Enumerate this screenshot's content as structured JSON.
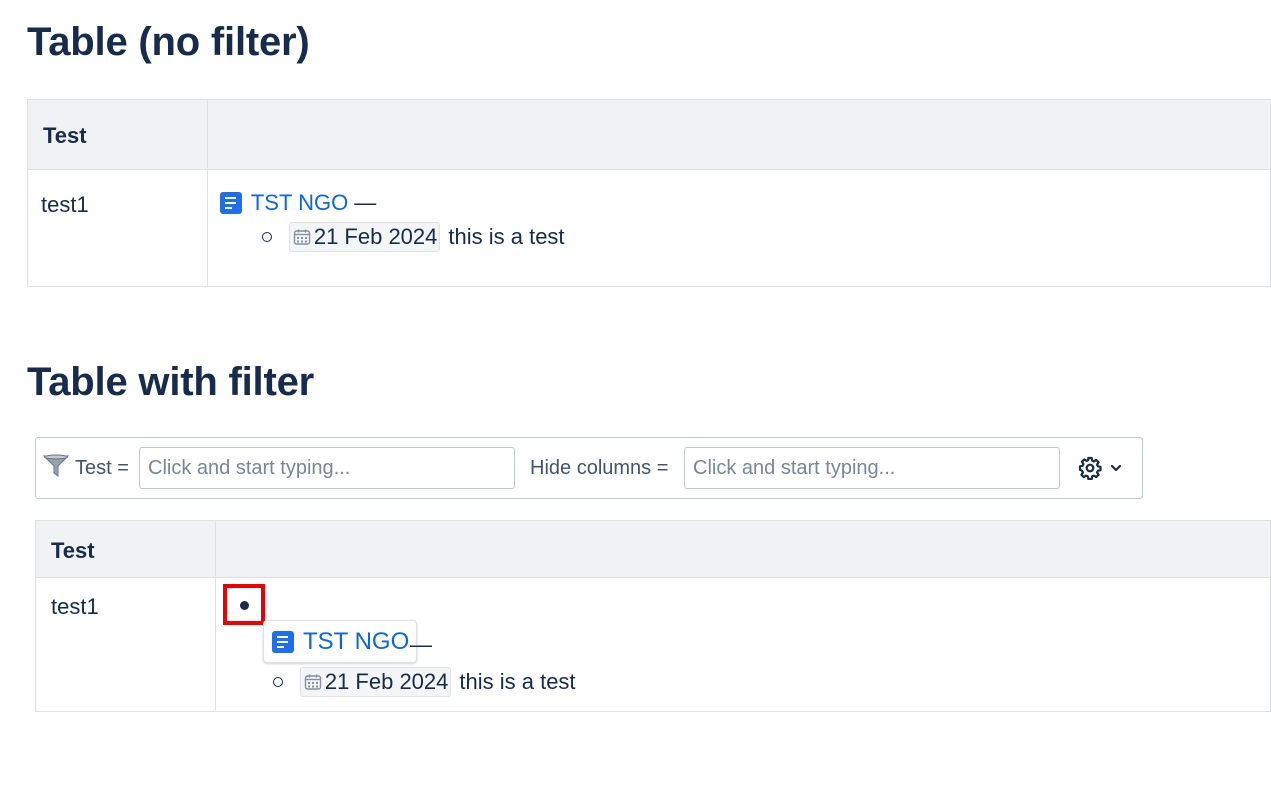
{
  "sections": {
    "no_filter": {
      "title": "Table (no filter)",
      "columns": [
        "Test",
        ""
      ],
      "row": {
        "name": "test1",
        "link_text": "TST NGO",
        "separator": "—",
        "date": "21 Feb 2024",
        "description": "this is a test"
      }
    },
    "with_filter": {
      "title": "Table with filter",
      "filter": {
        "test_label": "Test =",
        "test_placeholder": "Click and start typing...",
        "hide_label": "Hide columns =",
        "hide_placeholder": "Click and start typing..."
      },
      "columns": [
        "Test",
        ""
      ],
      "row": {
        "name": "test1",
        "link_text": "TST NGO",
        "separator": "—",
        "date": "21 Feb 2024",
        "description": "this is a test"
      }
    }
  },
  "icons": {
    "page": "page-icon",
    "calendar": "calendar-icon",
    "filter": "filter-icon",
    "gear": "gear-icon",
    "chevron": "chevron-down-icon"
  },
  "colors": {
    "link": "#0c66e4",
    "text": "#172b4d",
    "header_bg": "#f1f2f4",
    "highlight": "#ee0000"
  }
}
